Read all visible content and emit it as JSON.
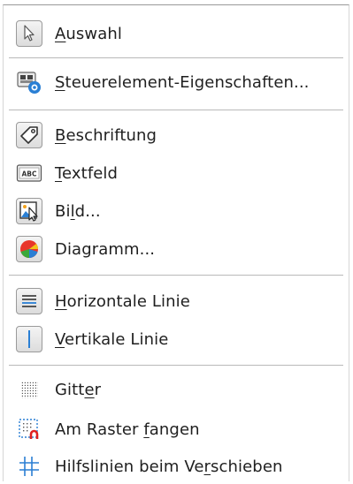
{
  "menu": {
    "items": [
      {
        "id": "auswahl",
        "label": "Auswahl",
        "mnemonic_index": 0,
        "icon": "pointer-icon"
      },
      {
        "id": "steuerelement",
        "label": "Steuerelement-Eigenschaften...",
        "mnemonic_index": 0,
        "icon": "control-properties-icon"
      },
      {
        "id": "beschriftung",
        "label": "Beschriftung",
        "mnemonic_index": 0,
        "icon": "tag-icon"
      },
      {
        "id": "textfeld",
        "label": "Textfeld",
        "mnemonic_index": 0,
        "icon": "abc-textbox-icon"
      },
      {
        "id": "bild",
        "label": "Bild...",
        "mnemonic_index": 2,
        "icon": "image-icon"
      },
      {
        "id": "diagramm",
        "label": "Diagramm...",
        "mnemonic_index": -1,
        "icon": "chart-pie-icon"
      },
      {
        "id": "horizontale",
        "label": "Horizontale Linie",
        "mnemonic_index": 0,
        "icon": "horizontal-line-icon"
      },
      {
        "id": "vertikale",
        "label": "Vertikale Linie",
        "mnemonic_index": 0,
        "icon": "vertical-line-icon"
      },
      {
        "id": "gitter",
        "label": "Gitter",
        "mnemonic_index": 4,
        "icon": "grid-dots-icon"
      },
      {
        "id": "raster",
        "label": "Am Raster fangen",
        "mnemonic_index": 10,
        "icon": "snap-grid-icon"
      },
      {
        "id": "hilfslinien",
        "label": "Hilfslinien beim Verschieben",
        "mnemonic_index": 19,
        "icon": "helplines-icon"
      }
    ]
  },
  "colors": {
    "accent_blue": "#2a7fd4",
    "chart_red": "#e8352a",
    "chart_green": "#3aa83a",
    "chart_yellow": "#f3c219",
    "magnet_red": "#e02020"
  }
}
